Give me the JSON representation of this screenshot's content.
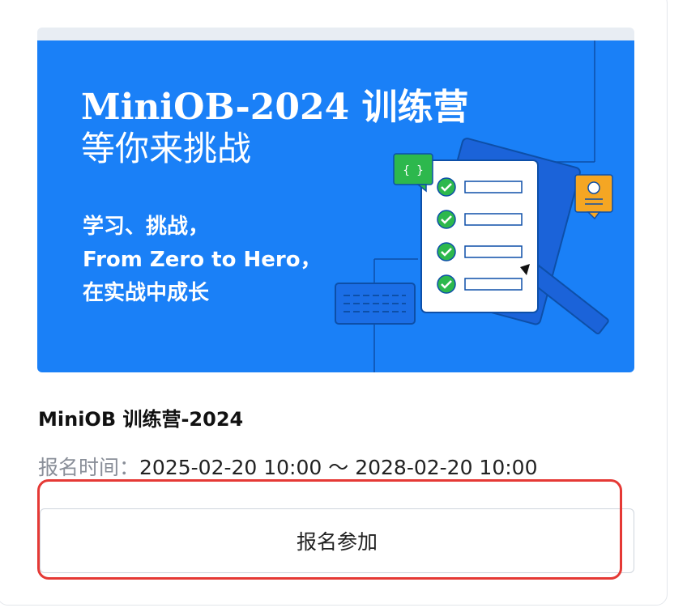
{
  "banner": {
    "title": "MiniOB-2024 训练营",
    "subtitle": "等你来挑战",
    "line1": "学习、挑战，",
    "line2": "From Zero to Hero，",
    "line3": "在实战中成长",
    "code_badge": "{ }"
  },
  "card": {
    "title": "MiniOB 训练营-2024",
    "time_label": "报名时间：",
    "time_value": "2025-02-20 10:00 ～ 2028-02-20 10:00",
    "register_label": "报名参加"
  },
  "colors": {
    "banner_bg": "#1a80f7",
    "highlight": "#e53935",
    "check": "#2db84d",
    "badge_orange": "#f5a623"
  }
}
